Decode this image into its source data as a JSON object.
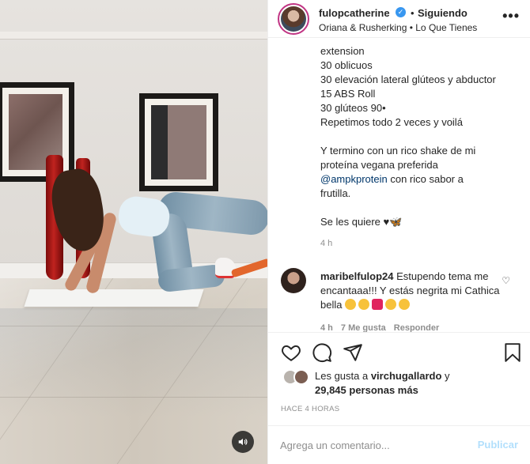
{
  "header": {
    "username": "fulopcatherine",
    "verified_mark": "✓",
    "separator": "•",
    "follow_status": "Siguiendo",
    "audio": "Oriana & Rusherking • Lo Que Tienes",
    "more_label": "•••"
  },
  "caption": {
    "lines": [
      "extension",
      "30 oblicuos",
      "30 elevación lateral glúteos y abductor",
      "15 ABS Roll",
      "30 glúteos 90•",
      "Repetimos todo 2 veces y voilá",
      "",
      "Y termino con un rico shake de mi",
      "proteína vegana preferida"
    ],
    "mention": "@ampkprotein",
    "mention_rest": " con rico sabor a",
    "line_after": "frutilla.",
    "signoff": "Se les quiere",
    "signoff_emoji": "♥🦋",
    "time": "4 h"
  },
  "comment": {
    "username": "maribelfulop24",
    "text": " Estupendo tema me encantaaa!!! Y estás negrita mi Cathica bella ",
    "time": "4 h",
    "likes": "7 Me gusta",
    "reply": "Responder"
  },
  "likes": {
    "prefix": "Les gusta a ",
    "first_liker": "virchugallardo",
    "conj": " y",
    "count_text": "29,845 personas más"
  },
  "timestamp": "HACE 4 HORAS",
  "add_comment": {
    "placeholder": "Agrega un comentario...",
    "publish": "Publicar"
  },
  "icons": {
    "like": "heart-icon",
    "comment": "comment-icon",
    "share": "share-icon",
    "save": "bookmark-icon",
    "sound": "speaker-icon"
  },
  "colors": {
    "link": "#00376b",
    "publish_disabled": "#b2dffc",
    "verified": "#3897f0",
    "muted": "#8e8e8e"
  }
}
